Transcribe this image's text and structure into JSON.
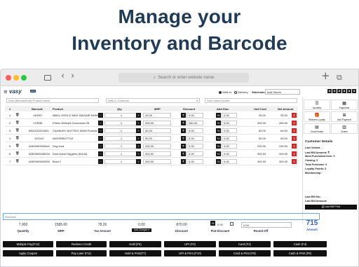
{
  "headline": {
    "line1": "Manage your",
    "line2": "Inventory and Barcode"
  },
  "browser": {
    "url_placeholder": "Search or enter website name",
    "sidebar_icon": "sidebar-icon",
    "back_icon": "‹",
    "forward_icon": "›",
    "new_tab_icon": "+",
    "tabs_icon": "⧉"
  },
  "app": {
    "logo": "vasy",
    "logo_badge": "ERP",
    "radio_walkin": "Walk In",
    "radio_delivery": "Delivery",
    "salesman_label": "Salesman:",
    "salesman_value": "Add Stores",
    "scan_placeholder": "Scan Barcode/Enter Product Name",
    "customer_placeholder": "Walk In Customer",
    "sales_invoice_placeholder": "Scan Sales Invoice",
    "accent_color": "#2d63c8",
    "heading_color": "#1f3b57"
  },
  "table": {
    "headers": [
      "#",
      "Barcode",
      "Product",
      "Qty",
      "MRP",
      "Discount",
      "Add Disc",
      "Unit Cost",
      "Net Amount"
    ],
    "rows": [
      {
        "n": "1",
        "barcode": "140097",
        "product": "AMUL GOOLD MILK BAG(NR 500ML",
        "qty": "1",
        "mrp": "25.00",
        "disc": "0.00",
        "add": "0.00",
        "unit": "25.00",
        "net": "25.00"
      },
      {
        "n": "2",
        "barcode": "179938",
        "product": "Primio Refined Groundnut Oil",
        "qty": "1",
        "mrp": "300.00",
        "disc": "280.00",
        "add": "0.00",
        "unit": "300.00",
        "net": "280.00"
      },
      {
        "n": "3",
        "barcode": "8901233021601",
        "product": "CADBURY NUTTIES 300M Product",
        "qty": "1",
        "mrp": "60.00",
        "disc": "0.00",
        "add": "0.00",
        "unit": "60.00",
        "net": "60.00"
      },
      {
        "n": "4",
        "barcode": "101010",
        "product": "WATERBOTTLE",
        "qty": "1",
        "mrp": "50.00",
        "disc": "0.00",
        "add": "0.00",
        "unit": "50.00",
        "net": "50.00"
      },
      {
        "n": "5",
        "barcode": "A0K0000000649",
        "product": "Dog food",
        "qty": "1",
        "mrp": "200.00",
        "disc": "0.00",
        "add": "0.00",
        "unit": "200.00",
        "net": "200.00"
      },
      {
        "n": "6",
        "barcode": "A0K0000045030",
        "product": "Dont Kand Ol(g)hhs (Kl444)",
        "qty": "1",
        "mrp": "300.00",
        "disc": "0.00",
        "add": "0.00",
        "unit": "300.00",
        "net": "300.00"
      },
      {
        "n": "7",
        "barcode": "A0K0000000533",
        "product": "Bowl 1",
        "qty": "1",
        "mrp": "300.00",
        "disc": "0.00",
        "add": "0.00",
        "unit": "300.00",
        "net": "300.00"
      }
    ]
  },
  "right_panel": {
    "tiles": [
      {
        "label": "Updates",
        "icon": "☰"
      },
      {
        "label": "Payments",
        "icon": "▦"
      },
      {
        "label": "Redeem Loyalty",
        "icon": "🎁"
      },
      {
        "label": "Add Payment",
        "icon": "⊞"
      },
      {
        "label": "Credit Notes",
        "icon": "▤"
      },
      {
        "label": "Orders",
        "icon": "▥"
      }
    ],
    "customer_title": "Customer Details",
    "customer_lines": [
      "Last Visited : -",
      "Last Bill Amount: ₹",
      "Most Purchased Item: 0",
      "Closing: 0",
      "Total Purchase: 0",
      "Loyalty Points: 0",
      "Membership:"
    ],
    "last_bill_no": "Last Bill No.:",
    "last_bill_amount": "Last Bill Amount:",
    "last_bill_print": "Last Bill Print"
  },
  "remarks_placeholder": "Remarks",
  "totals": {
    "quantity_value": "7.000",
    "quantity_label": "Quantity",
    "mrp_value": "1585.00",
    "mrp_label": "MRP",
    "tax_value": "78.26",
    "tax_label": "Tax Amount",
    "charges_value": "0.00",
    "charges_btn": "Add Charges ▾",
    "discount_value": "870.00",
    "discount_label": "Discount",
    "flat_value": "0.00",
    "flat_label": "Flat Discount",
    "roundoff_label": "Round Off",
    "amount_value": "715",
    "amount_label": "Amount",
    "pay_input": "0.00"
  },
  "pay_buttons_row1": [
    "Multiple Pay(F12)",
    "Redeem Credit",
    "Hold (F6)",
    "UPI (F3)",
    "Card (F2)",
    "Cash (F4)"
  ],
  "pay_buttons_row2": [
    "Apply Coupon",
    "Pay Later (F11)",
    "Hold & Print(F7)",
    "UPI & Print (F10)",
    "Card & Print (F9)",
    "Cash & Print (F8)"
  ]
}
